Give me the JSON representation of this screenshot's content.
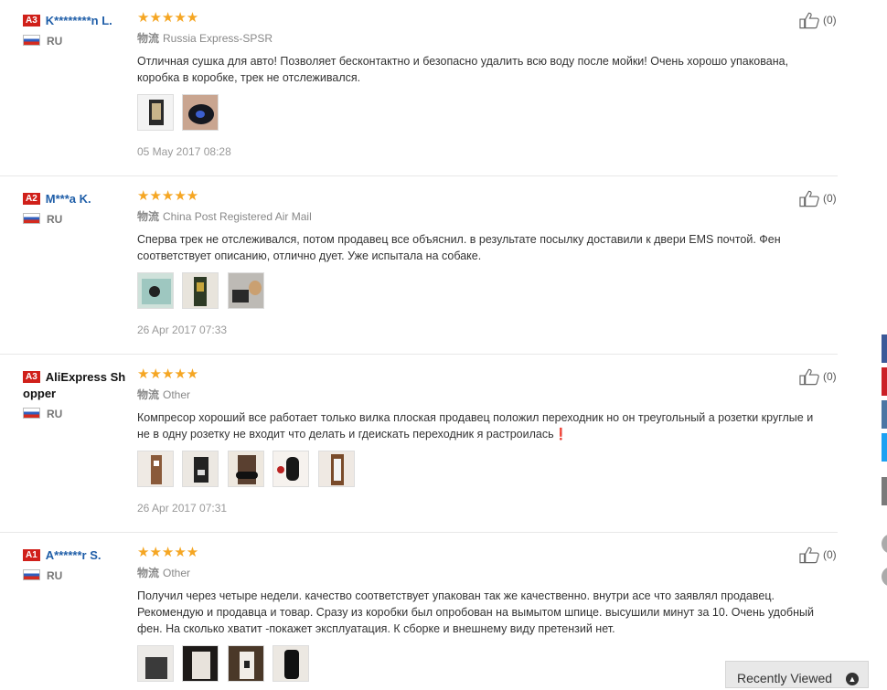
{
  "reviews": [
    {
      "level": "A3",
      "name": "K********n L.",
      "country": "RU",
      "stars": "★★★★★",
      "ship_label": "物流",
      "ship": "Russia Express-SPSR",
      "text": "Отличная сушка для авто! Позволяет бесконтактно и безопасно удалить всю воду после мойки! Очень хорошо упакована, коробка в коробке, трек не отслеживался.",
      "date": "05 May 2017 08:28",
      "likes": "(0)"
    },
    {
      "level": "A2",
      "name": "M***a K.",
      "country": "RU",
      "stars": "★★★★★",
      "ship_label": "物流",
      "ship": "China Post Registered Air Mail",
      "text": "Сперва трек не отслеживался, потом продавец все объяснил. в результате посылку доставили к двери EMS почтой. Фен соответствует описанию, отлично дует. Уже испытала на собаке.",
      "date": "26 Apr 2017 07:33",
      "likes": "(0)"
    },
    {
      "level": "A3",
      "name": "AliExpress Shopper",
      "country": "RU",
      "stars": "★★★★★",
      "ship_label": "物流",
      "ship": "Other",
      "text": "Компресор хороший все работает только вилка плоская продавец положил переходник но он треугольный а розетки круглые и не в одну розетку не входит что делать и гдеискать переходник я растроилась❗",
      "date": "26 Apr 2017 07:31",
      "likes": "(0)"
    },
    {
      "level": "A1",
      "name": "A******r S.",
      "country": "RU",
      "stars": "★★★★★",
      "ship_label": "物流",
      "ship": "Other",
      "text": "Получил через четыре недели. качество соответствует упакован так же качественно. внутри асе что заявлял продавец. Рекомендую и продавца и товар. Сразу из коробки был опробован на вымытом шпице. высушили минут за 10. Очень удобный фен. На сколько хватит -покажет эксплуатация. К сборке и внешнему виду претензий нет.",
      "date": "",
      "likes": "(0)"
    }
  ],
  "recently_viewed": "Recently Viewed",
  "colors": {
    "star": "#f5a623",
    "level_badge": "#d0201a",
    "username": "#1f5ea8",
    "share_facebook": "#3b5998",
    "share_pinterest": "#cb2027",
    "share_vk": "#4c75a3",
    "share_twitter": "#1da1f2"
  }
}
